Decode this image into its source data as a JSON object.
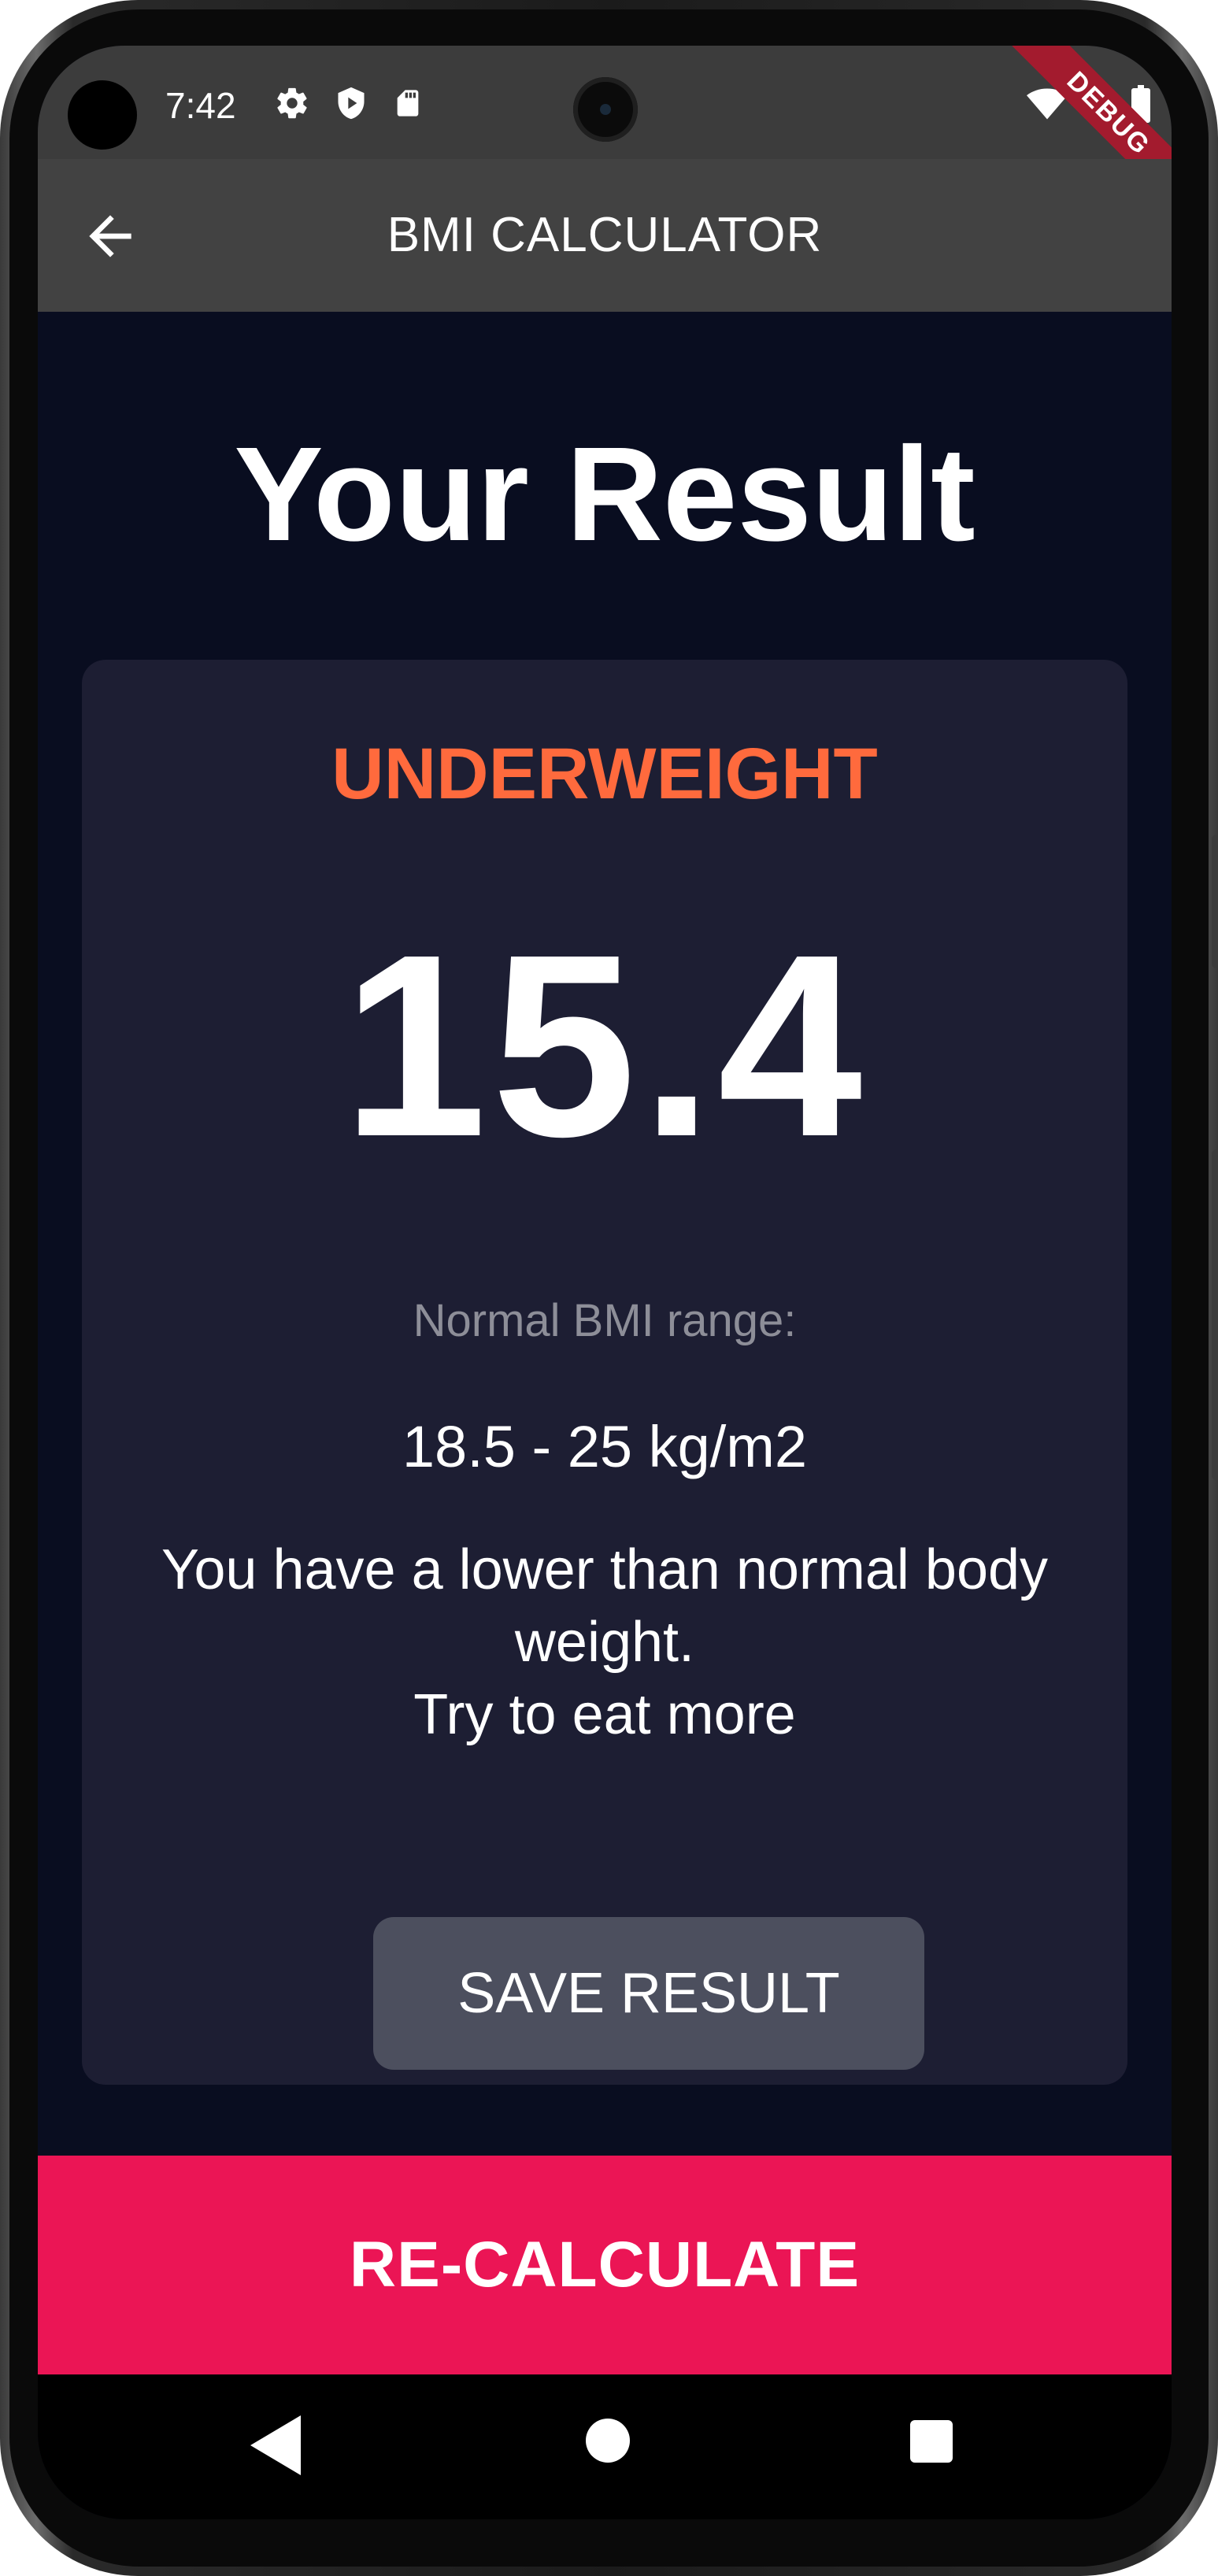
{
  "status_bar": {
    "time": "7:42",
    "icons_left": [
      "gear-icon",
      "shield-icon",
      "sd-card-icon"
    ],
    "icons_right": [
      "wifi-icon",
      "signal-icon",
      "battery-icon"
    ],
    "debug_banner": "DEBUG"
  },
  "app_bar": {
    "title": "BMI CALCULATOR",
    "back_icon": "arrow-back-icon"
  },
  "page": {
    "title": "Your Result"
  },
  "result": {
    "status": "UNDERWEIGHT",
    "status_color": "#ff6a3d",
    "bmi": "15.4",
    "range_label": "Normal BMI range:",
    "range_value": "18.5 - 25 kg/m2",
    "message_line1": "You have a lower than normal body weight.",
    "message_line2": "Try to eat more"
  },
  "buttons": {
    "save_label": "SAVE RESULT",
    "recalculate_label": "RE-CALCULATE",
    "recalculate_color": "#eb1555"
  },
  "nav_bar": {
    "icons": [
      "nav-back-icon",
      "nav-home-icon",
      "nav-recent-apps-icon"
    ]
  },
  "colors": {
    "background": "#090d20",
    "card": "#1d1e33",
    "app_bar": "#424242"
  }
}
